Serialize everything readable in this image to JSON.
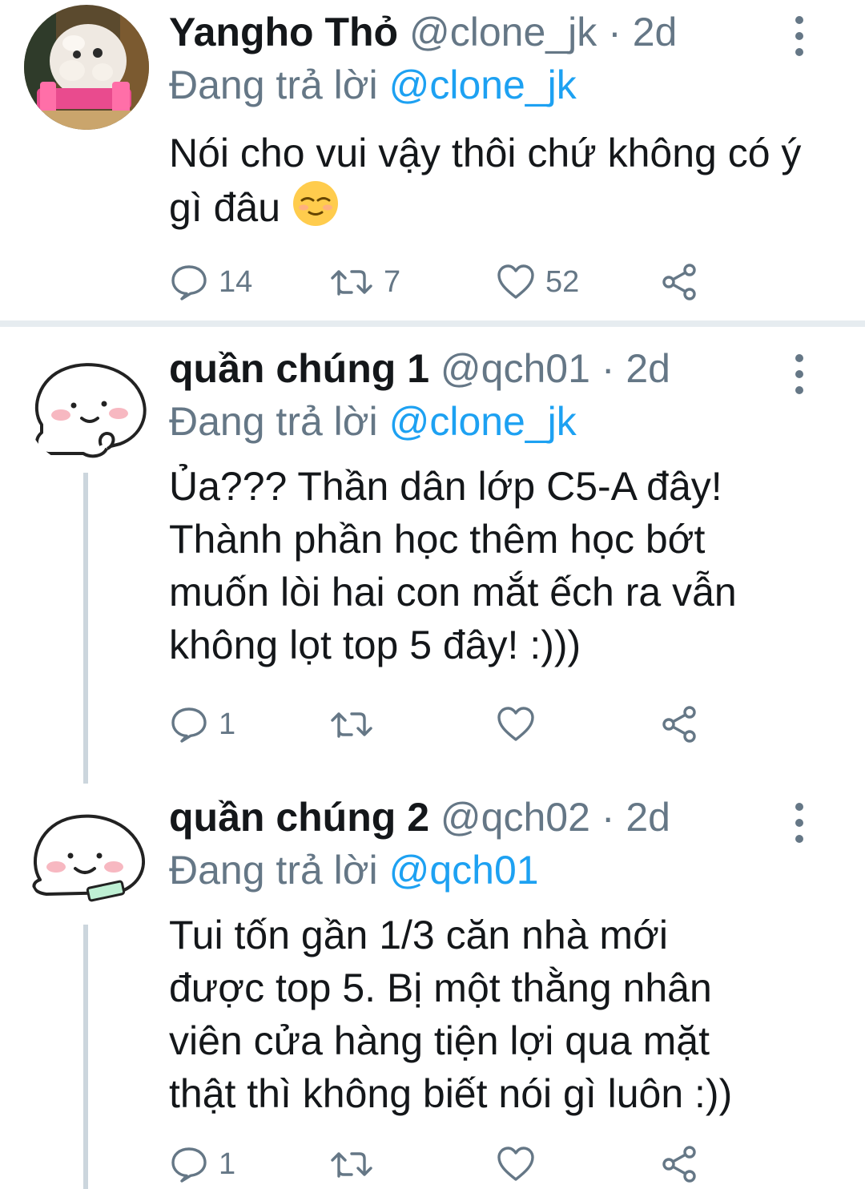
{
  "colors": {
    "text": "#14171a",
    "muted": "#657786",
    "mention": "#1da1f2",
    "divider": "#e6ecf0",
    "thread_line": "#ccd6dd"
  },
  "icons": {
    "reply": "speech-bubble-icon",
    "retweet": "retweet-icon",
    "like": "heart-icon",
    "share": "share-icon",
    "more": "vertical-ellipsis-icon",
    "emoji": "relieved-face-emoji"
  },
  "tweets": [
    {
      "display_name": "Yangho Thỏ",
      "handle": "@clone_jk",
      "separator": "·",
      "time": "2d",
      "replying_prefix": "Đang trả lời",
      "replying_to": "@clone_jk",
      "text": "Nói cho vui vậy thôi chứ không có ý gì đâu",
      "emoji": "😌",
      "replies": "14",
      "retweets": "7",
      "likes": "52"
    },
    {
      "display_name": "quần chúng 1",
      "handle": "@qch01",
      "separator": "·",
      "time": "2d",
      "replying_prefix": "Đang trả lời",
      "replying_to": "@clone_jk",
      "text_lines": [
        "Ủa??? Thần dân lớp C5-A đây!",
        "Thành phần học thêm học bớt",
        "muốn lòi hai con mắt ếch ra vẫn",
        "không lọt top 5 đây! :)))"
      ],
      "replies": "1",
      "retweets": "",
      "likes": ""
    },
    {
      "display_name": "quần chúng 2",
      "handle": "@qch02",
      "separator": "·",
      "time": "2d",
      "replying_prefix": "Đang trả lời",
      "replying_to": "@qch01",
      "text_lines": [
        "Tui tốn gần 1/3 căn nhà mới",
        "được top 5. Bị một thằng nhân",
        "viên cửa hàng tiện lợi qua mặt",
        "thật thì không biết nói gì luôn :))"
      ],
      "replies": "1",
      "retweets": "",
      "likes": ""
    }
  ]
}
